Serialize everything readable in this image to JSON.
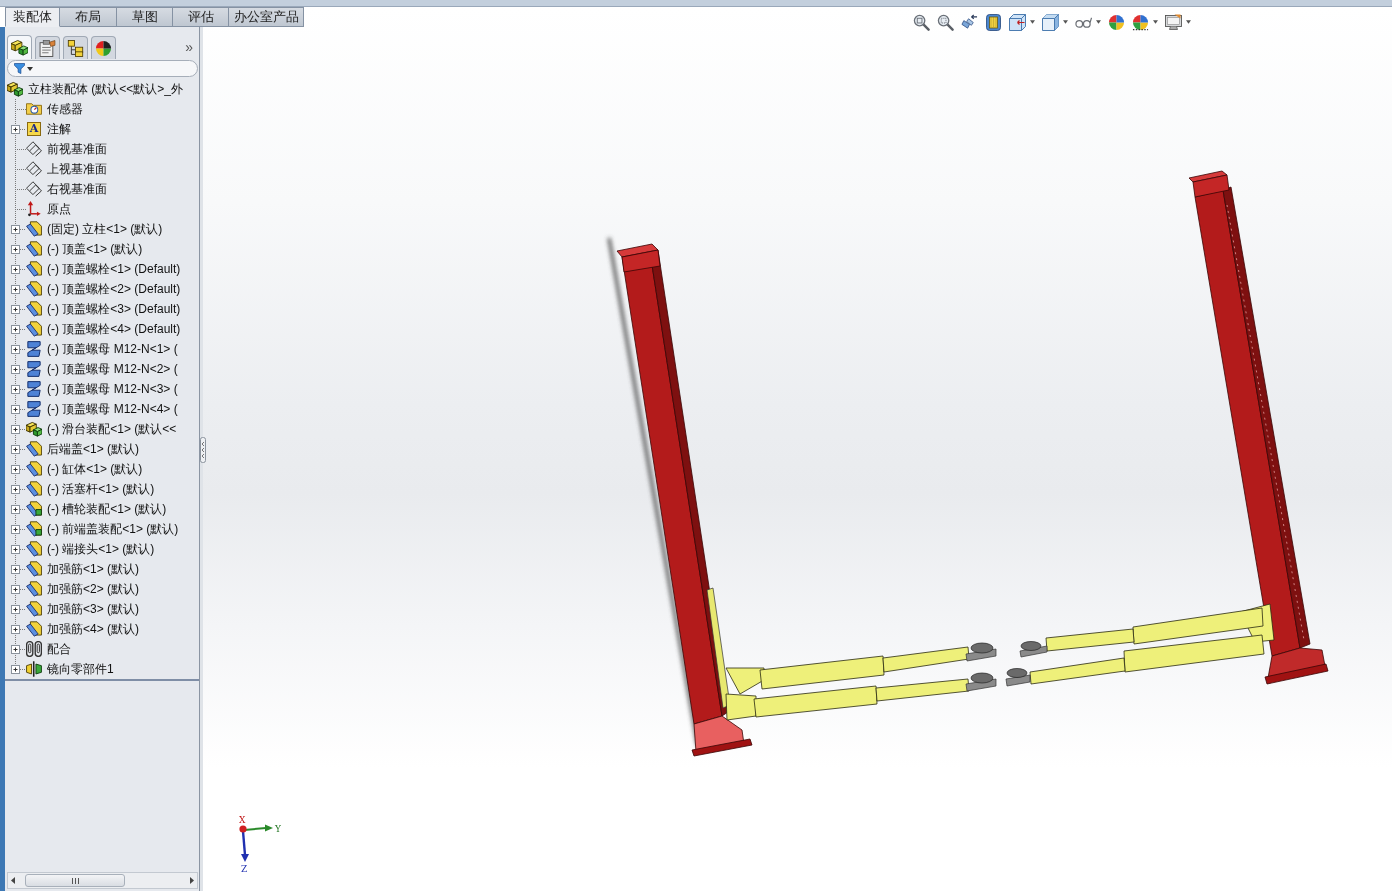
{
  "command_tabs": [
    {
      "label": "装配体",
      "selected": true
    },
    {
      "label": "布局",
      "selected": false
    },
    {
      "label": "草图",
      "selected": false
    },
    {
      "label": "评估",
      "selected": false
    },
    {
      "label": "办公室产品",
      "selected": false
    }
  ],
  "panel_tabs": [
    {
      "kind": "feature",
      "selected": true
    },
    {
      "kind": "property",
      "selected": false
    },
    {
      "kind": "configuration",
      "selected": false
    },
    {
      "kind": "display",
      "selected": false
    }
  ],
  "panel_more": "»",
  "feature_tree": {
    "root": {
      "label": "立柱装配体 (默认<<默认>_外",
      "kind": "assembly",
      "children": [
        {
          "label": "传感器",
          "kind": "sensor",
          "expandable": false
        },
        {
          "label": "注解",
          "kind": "annotation",
          "glyph": "A",
          "expandable": true
        },
        {
          "label": "前视基准面",
          "kind": "plane",
          "expandable": false
        },
        {
          "label": "上视基准面",
          "kind": "plane",
          "expandable": false
        },
        {
          "label": "右视基准面",
          "kind": "plane",
          "expandable": false
        },
        {
          "label": "原点",
          "kind": "origin",
          "expandable": false
        },
        {
          "label": "(固定) 立柱<1> (默认)",
          "kind": "part",
          "expandable": true
        },
        {
          "label": "(-) 顶盖<1> (默认)",
          "kind": "part",
          "expandable": true
        },
        {
          "label": "(-) 顶盖螺栓<1> (Default)",
          "kind": "part",
          "expandable": true
        },
        {
          "label": "(-) 顶盖螺栓<2> (Default)",
          "kind": "part",
          "expandable": true
        },
        {
          "label": "(-) 顶盖螺栓<3> (Default)",
          "kind": "part",
          "expandable": true
        },
        {
          "label": "(-) 顶盖螺栓<4> (Default)",
          "kind": "part",
          "expandable": true
        },
        {
          "label": "(-) 顶盖螺母 M12-N<1> (",
          "kind": "fastener",
          "expandable": true
        },
        {
          "label": "(-) 顶盖螺母 M12-N<2> (",
          "kind": "fastener",
          "expandable": true
        },
        {
          "label": "(-) 顶盖螺母 M12-N<3> (",
          "kind": "fastener",
          "expandable": true
        },
        {
          "label": "(-) 顶盖螺母 M12-N<4> (",
          "kind": "fastener",
          "expandable": true
        },
        {
          "label": "(-) 滑台装配<1> (默认<<",
          "kind": "assembly",
          "expandable": true
        },
        {
          "label": "后端盖<1> (默认)",
          "kind": "part",
          "expandable": true
        },
        {
          "label": "(-) 缸体<1> (默认)",
          "kind": "part",
          "expandable": true
        },
        {
          "label": "(-) 活塞杆<1> (默认)",
          "kind": "part",
          "expandable": true
        },
        {
          "label": "(-) 槽轮装配<1> (默认)",
          "kind": "subassembly",
          "expandable": true
        },
        {
          "label": "(-) 前端盖装配<1> (默认)",
          "kind": "subassembly",
          "expandable": true
        },
        {
          "label": "(-) 端接头<1> (默认)",
          "kind": "part",
          "expandable": true
        },
        {
          "label": "加强筋<1> (默认)",
          "kind": "part",
          "expandable": true
        },
        {
          "label": "加强筋<2> (默认)",
          "kind": "part",
          "expandable": true
        },
        {
          "label": "加强筋<3> (默认)",
          "kind": "part",
          "expandable": true
        },
        {
          "label": "加强筋<4> (默认)",
          "kind": "part",
          "expandable": true
        },
        {
          "label": "配合",
          "kind": "mates",
          "expandable": true
        },
        {
          "label": "镜向零部件1",
          "kind": "mirror",
          "expandable": true
        }
      ]
    }
  },
  "view_toolbar": [
    {
      "kind": "zoom-fit",
      "dropdown": false
    },
    {
      "kind": "zoom-area",
      "dropdown": false
    },
    {
      "kind": "previous-view",
      "dropdown": false
    },
    {
      "kind": "section-view",
      "dropdown": false
    },
    {
      "kind": "view-orientation",
      "dropdown": true
    },
    {
      "kind": "display-style",
      "dropdown": true
    },
    {
      "kind": "hide-show",
      "dropdown": true
    },
    {
      "kind": "appearance",
      "dropdown": false
    },
    {
      "kind": "scene",
      "dropdown": true
    },
    {
      "kind": "view-settings",
      "dropdown": true
    }
  ],
  "triad": {
    "x_label": "X",
    "y_label": "Y",
    "z_label": "Z"
  }
}
